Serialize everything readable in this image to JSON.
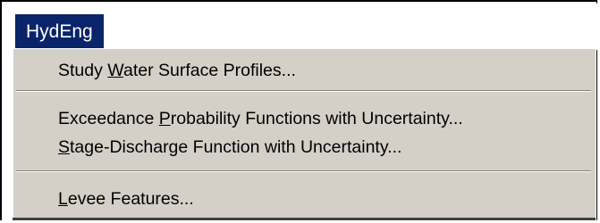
{
  "menubar": {
    "title": "HydEng"
  },
  "menu": {
    "items": [
      {
        "before": "Study ",
        "mnemonic": "W",
        "after": "ater Surface Profiles..."
      },
      {
        "before": "Exceedance ",
        "mnemonic": "P",
        "after": "robability Functions with Uncertainty..."
      },
      {
        "before": "",
        "mnemonic": "S",
        "after": "tage-Discharge Function with Uncertainty..."
      },
      {
        "before": "",
        "mnemonic": "L",
        "after": "evee Features..."
      }
    ]
  },
  "colors": {
    "menu_highlight": "#0a246a",
    "menu_background": "#d4d0c8",
    "separator": "#808080"
  }
}
